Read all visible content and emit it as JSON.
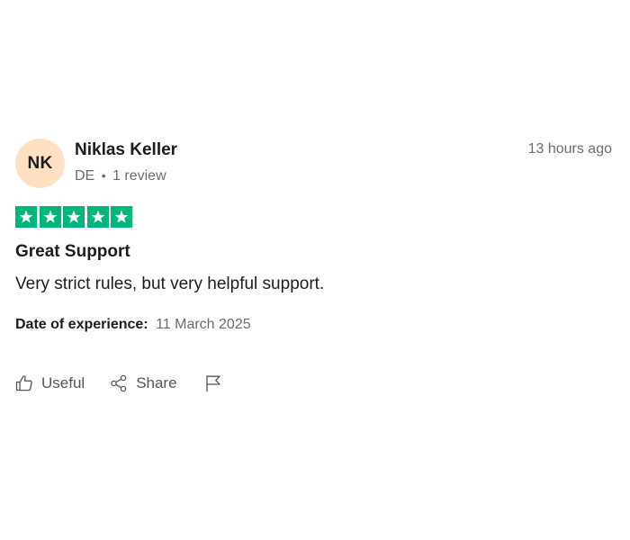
{
  "review": {
    "avatar_initials": "NK",
    "avatar_color": "#ffe0c2",
    "reviewer_name": "Niklas Keller",
    "country": "DE",
    "review_count": "1 review",
    "time_ago": "13 hours ago",
    "rating": 5,
    "rating_max": 5,
    "star_color": "#00b67a",
    "title": "Great Support",
    "body": "Very strict rules, but very helpful support.",
    "experience_label": "Date of experience:",
    "experience_date": "11 March 2025"
  },
  "actions": {
    "useful_label": "Useful",
    "useful_icon": "thumbs-up-icon",
    "share_label": "Share",
    "share_icon": "share-icon",
    "report_icon": "flag-icon"
  }
}
